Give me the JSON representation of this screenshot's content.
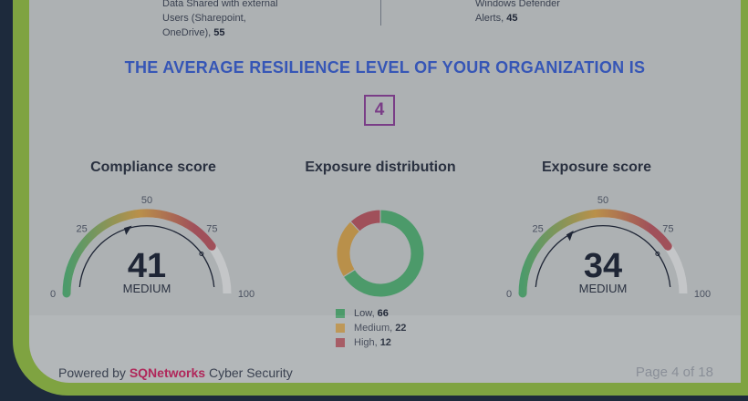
{
  "top_left": {
    "line1": "Data Shared with external",
    "line2": "Users (Sharepoint,",
    "line3_text": "OneDrive),",
    "line3_value": "55"
  },
  "top_right": {
    "line1": "Windows Defender",
    "line2_text": "Alerts,",
    "line2_value": "45"
  },
  "headline": "THE AVERAGE RESILIENCE LEVEL OF YOUR ORGANIZATION IS",
  "resilience_level": "4",
  "compliance": {
    "title": "Compliance score",
    "value": "41",
    "level": "MEDIUM",
    "score": 41,
    "ticks": [
      "0",
      "25",
      "50",
      "75",
      "100"
    ]
  },
  "distribution": {
    "title": "Exposure distribution",
    "items": [
      {
        "label": "Low,",
        "value": "66",
        "amount": 66,
        "color": "#4c9a6a"
      },
      {
        "label": "Medium,",
        "value": "22",
        "amount": 22,
        "color": "#b9904a"
      },
      {
        "label": "High,",
        "value": "12",
        "amount": 12,
        "color": "#a0505a"
      }
    ]
  },
  "exposure": {
    "title": "Exposure score",
    "value": "34",
    "level": "MEDIUM",
    "score": 34,
    "ticks": [
      "0",
      "25",
      "50",
      "75",
      "100"
    ]
  },
  "footer": {
    "powered_prefix": "Powered by",
    "brand": "SQNetworks",
    "powered_suffix": "Cyber Security",
    "page": "Page 4 of 18"
  },
  "colors": {
    "green": "#4c9a6a",
    "amber": "#b9904a",
    "red": "#a0505a",
    "track": "#c4c6c8",
    "accent_blue": "#3656b6",
    "accent_purple": "#7a3d87",
    "brand_pink": "#b0275a"
  }
}
